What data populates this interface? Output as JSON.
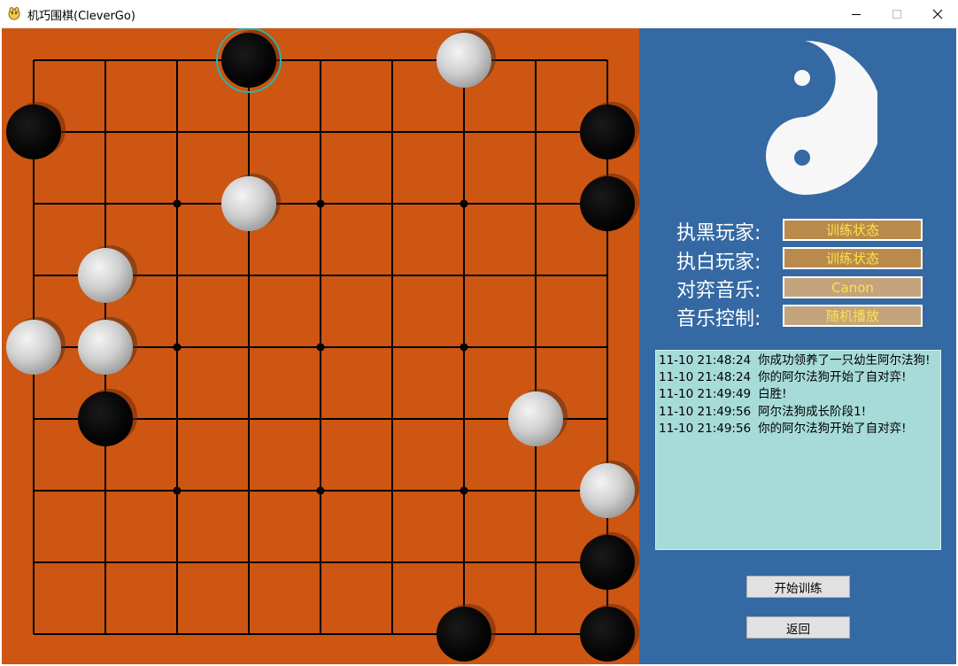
{
  "window": {
    "title": "机巧围棋(CleverGo)",
    "icons": {
      "app": "app-icon",
      "minimize": "minimize-icon",
      "maximize": "maximize-icon",
      "close": "close-icon"
    }
  },
  "board": {
    "size": 9,
    "star_points": [
      [
        2,
        2
      ],
      [
        4,
        2
      ],
      [
        6,
        2
      ],
      [
        2,
        4
      ],
      [
        4,
        4
      ],
      [
        6,
        4
      ],
      [
        2,
        6
      ],
      [
        4,
        6
      ],
      [
        6,
        6
      ]
    ],
    "last_move": [
      3,
      0
    ],
    "stones": [
      {
        "color": "black",
        "col": 3,
        "row": 0
      },
      {
        "color": "white",
        "col": 6,
        "row": 0
      },
      {
        "color": "black",
        "col": 0,
        "row": 1
      },
      {
        "color": "black",
        "col": 8,
        "row": 1
      },
      {
        "color": "white",
        "col": 3,
        "row": 2
      },
      {
        "color": "black",
        "col": 8,
        "row": 2
      },
      {
        "color": "white",
        "col": 1,
        "row": 3
      },
      {
        "color": "white",
        "col": 0,
        "row": 4
      },
      {
        "color": "white",
        "col": 1,
        "row": 4
      },
      {
        "color": "black",
        "col": 1,
        "row": 5
      },
      {
        "color": "white",
        "col": 7,
        "row": 5
      },
      {
        "color": "white",
        "col": 8,
        "row": 6
      },
      {
        "color": "black",
        "col": 8,
        "row": 7
      },
      {
        "color": "black",
        "col": 6,
        "row": 8
      },
      {
        "color": "black",
        "col": 8,
        "row": 8
      }
    ],
    "colors": {
      "wood": "#cc5612",
      "line": "#000000",
      "highlight": "#2bb3a8"
    }
  },
  "panel": {
    "logo": "yin-yang-icon",
    "black_player_label": "执黑玩家:",
    "black_player_value": "训练状态",
    "white_player_label": "执白玩家:",
    "white_player_value": "训练状态",
    "music_label": "对弈音乐:",
    "music_value": "Canon",
    "music_control_label": "音乐控制:",
    "music_control_value": "随机播放",
    "log": [
      {
        "time": "11-10 21:48:24",
        "text": "你成功领养了一只幼生阿尔法狗!"
      },
      {
        "time": "11-10 21:48:24",
        "text": "你的阿尔法狗开始了自对弈!"
      },
      {
        "time": "11-10 21:49:49",
        "text": "白胜!"
      },
      {
        "time": "11-10 21:49:56",
        "text": "阿尔法狗成长阶段1!"
      },
      {
        "time": "11-10 21:49:56",
        "text": "你的阿尔法狗开始了自对弈!"
      }
    ],
    "start_button": "开始训练",
    "back_button": "返回",
    "colors": {
      "panel_bg": "#3469a3",
      "field_text": "#ffe24a",
      "log_bg": "#a6dbd8"
    }
  }
}
